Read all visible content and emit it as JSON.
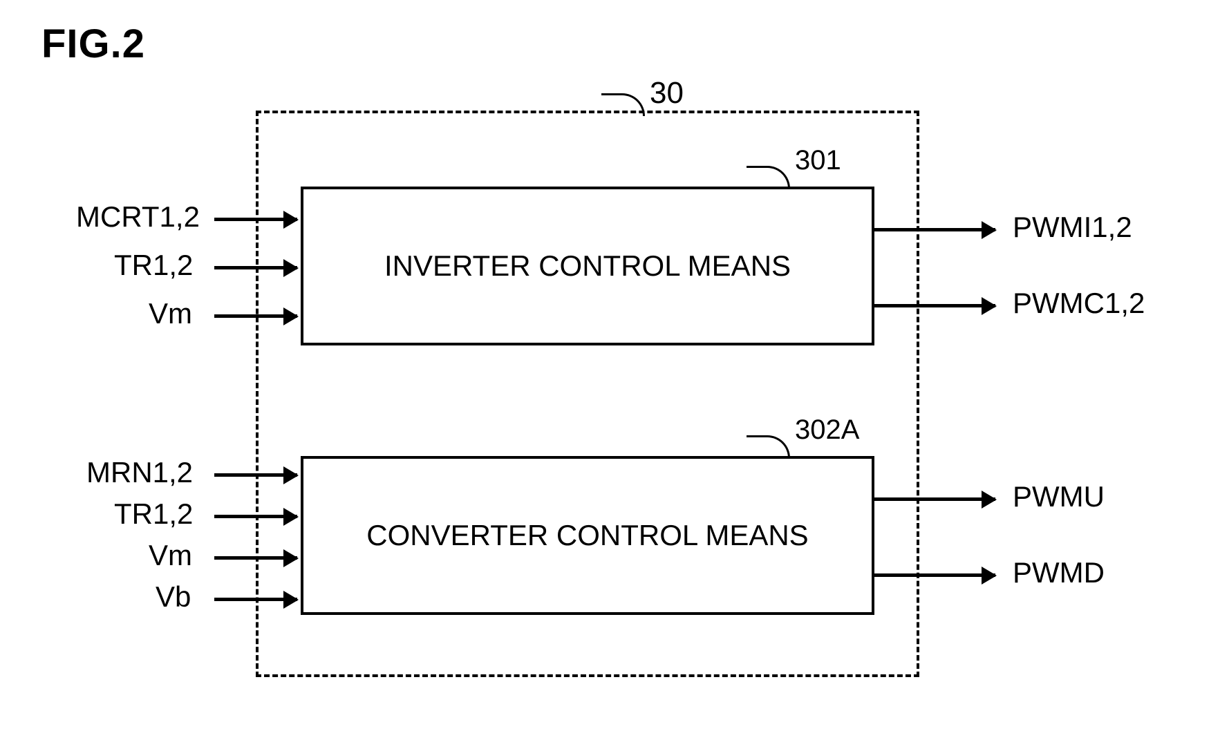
{
  "figure": {
    "title": "FIG.2",
    "container_ref": "30"
  },
  "blocks": {
    "inverter": {
      "ref": "301",
      "label": "INVERTER CONTROL MEANS",
      "inputs": [
        "MCRT1,2",
        "TR1,2",
        "Vm"
      ],
      "outputs": [
        "PWMI1,2",
        "PWMC1,2"
      ]
    },
    "converter": {
      "ref": "302A",
      "label": "CONVERTER CONTROL MEANS",
      "inputs": [
        "MRN1,2",
        "TR1,2",
        "Vm",
        "Vb"
      ],
      "outputs": [
        "PWMU",
        "PWMD"
      ]
    }
  }
}
